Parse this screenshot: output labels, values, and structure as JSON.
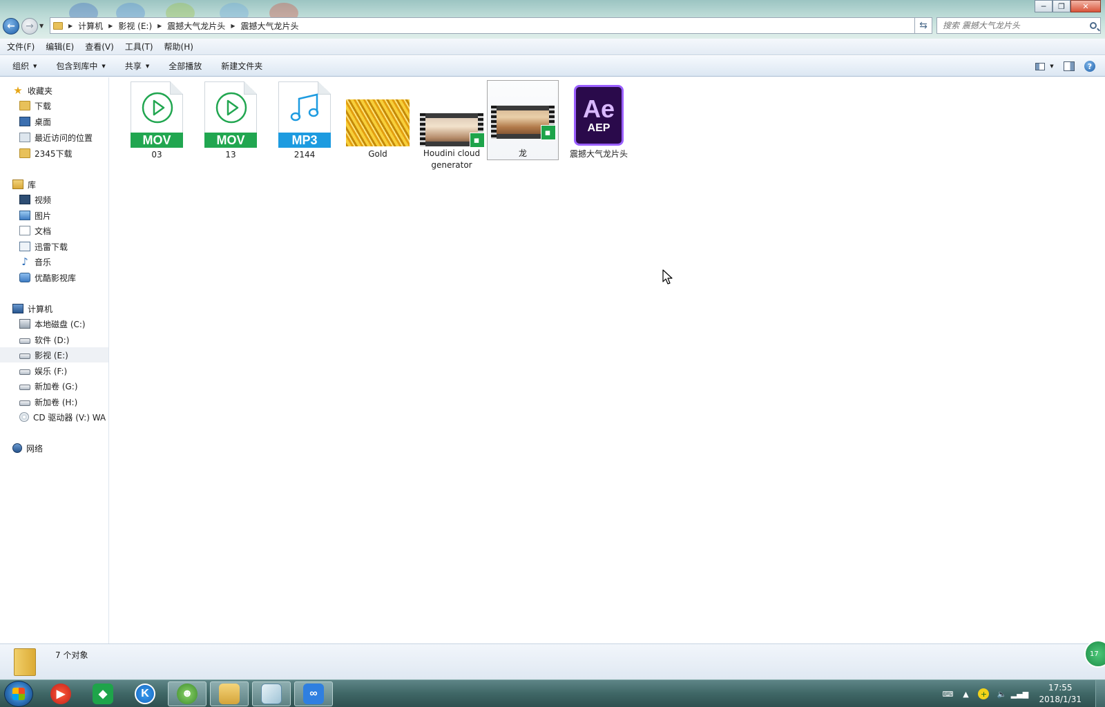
{
  "window": {
    "title_controls": {
      "minimize": "─",
      "maximize": "❐",
      "close": "✕"
    }
  },
  "address": {
    "crumbs": [
      "计算机",
      "影视 (E:)",
      "震撼大气龙片头",
      "震撼大气龙片头"
    ],
    "search_placeholder": "搜索 震撼大气龙片头"
  },
  "menu": [
    "文件(F)",
    "编辑(E)",
    "查看(V)",
    "工具(T)",
    "帮助(H)"
  ],
  "toolbar": {
    "organize": "组织",
    "include_library": "包含到库中",
    "share": "共享",
    "play_all": "全部播放",
    "new_folder": "新建文件夹"
  },
  "sidebar": {
    "favorites": {
      "label": "收藏夹",
      "items": [
        "下载",
        "桌面",
        "最近访问的位置",
        "2345下载"
      ]
    },
    "libraries": {
      "label": "库",
      "items": [
        "视频",
        "图片",
        "文档",
        "迅雷下载",
        "音乐",
        "优酷影视库"
      ]
    },
    "computer": {
      "label": "计算机",
      "items": [
        "本地磁盘 (C:)",
        "软件 (D:)",
        "影视 (E:)",
        "娱乐 (F:)",
        "新加卷 (G:)",
        "新加卷 (H:)",
        "CD 驱动器 (V:) WA"
      ]
    },
    "selected": "影视 (E:)",
    "network": {
      "label": "网络"
    }
  },
  "files": [
    {
      "name": "03",
      "type": "MOV",
      "color": "#21a650",
      "icon": "play-icon"
    },
    {
      "name": "13",
      "type": "MOV",
      "color": "#21a650",
      "icon": "play-icon"
    },
    {
      "name": "2144",
      "type": "MP3",
      "color": "#1d9be0",
      "icon": "music-note-icon"
    },
    {
      "name": "Gold",
      "type": "image",
      "icon": "gold-texture-thumbnail"
    },
    {
      "name": "Houdini cloud generator",
      "type": "video",
      "icon": "video-thumbnail"
    },
    {
      "name": "龙",
      "type": "video",
      "icon": "video-thumbnail",
      "selected": true
    },
    {
      "name": "震撼大气龙片头",
      "type": "AEP",
      "ae_letters": "Ae",
      "ae_ext": "AEP",
      "color": "#9a5fff"
    }
  ],
  "status": {
    "count_text": "7 个对象",
    "floating_badge": "17"
  },
  "taskbar": {
    "apps": [
      "media-player",
      "green-app",
      "kugou",
      "frog-app",
      "file-explorer",
      "notepad",
      "baidu-netdisk"
    ],
    "clock": {
      "time": "17:55",
      "date": "2018/1/31"
    }
  }
}
